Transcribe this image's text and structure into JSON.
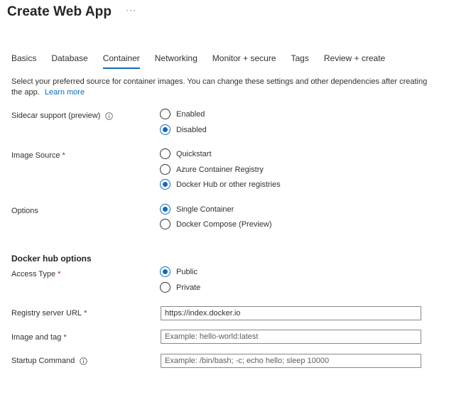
{
  "header": {
    "title": "Create Web App",
    "more_label": "···"
  },
  "tabs": [
    {
      "label": "Basics"
    },
    {
      "label": "Database"
    },
    {
      "label": "Container"
    },
    {
      "label": "Networking"
    },
    {
      "label": "Monitor + secure"
    },
    {
      "label": "Tags"
    },
    {
      "label": "Review + create"
    }
  ],
  "active_tab": "Container",
  "intro": {
    "text": "Select your preferred source for container images. You can change these settings and other dependencies after creating the app.",
    "link": "Learn more"
  },
  "sidecar": {
    "label": "Sidecar support (preview)",
    "options": [
      "Enabled",
      "Disabled"
    ],
    "selected": "Disabled"
  },
  "image_source": {
    "label": "Image Source",
    "required_mark": "*",
    "options": [
      "Quickstart",
      "Azure Container Registry",
      "Docker Hub or other registries"
    ],
    "selected": "Docker Hub or other registries"
  },
  "options": {
    "label": "Options",
    "options": [
      "Single Container",
      "Docker Compose (Preview)"
    ],
    "selected": "Single Container"
  },
  "docker_hub": {
    "heading": "Docker hub options",
    "access_type": {
      "label": "Access Type",
      "required_mark": "*",
      "options": [
        "Public",
        "Private"
      ],
      "selected": "Public"
    },
    "registry_url": {
      "label": "Registry server URL",
      "required_mark": "*",
      "value": "https://index.docker.io",
      "placeholder": ""
    },
    "image_tag": {
      "label": "Image and tag",
      "required_mark": "*",
      "value": "",
      "placeholder": "Example: hello-world:latest"
    },
    "startup_command": {
      "label": "Startup Command",
      "value": "",
      "placeholder": "Example: /bin/bash; -c; echo hello; sleep 10000"
    }
  },
  "colors": {
    "accent": "#0f6cbd",
    "required": "#a4262c",
    "text": "#323130"
  }
}
